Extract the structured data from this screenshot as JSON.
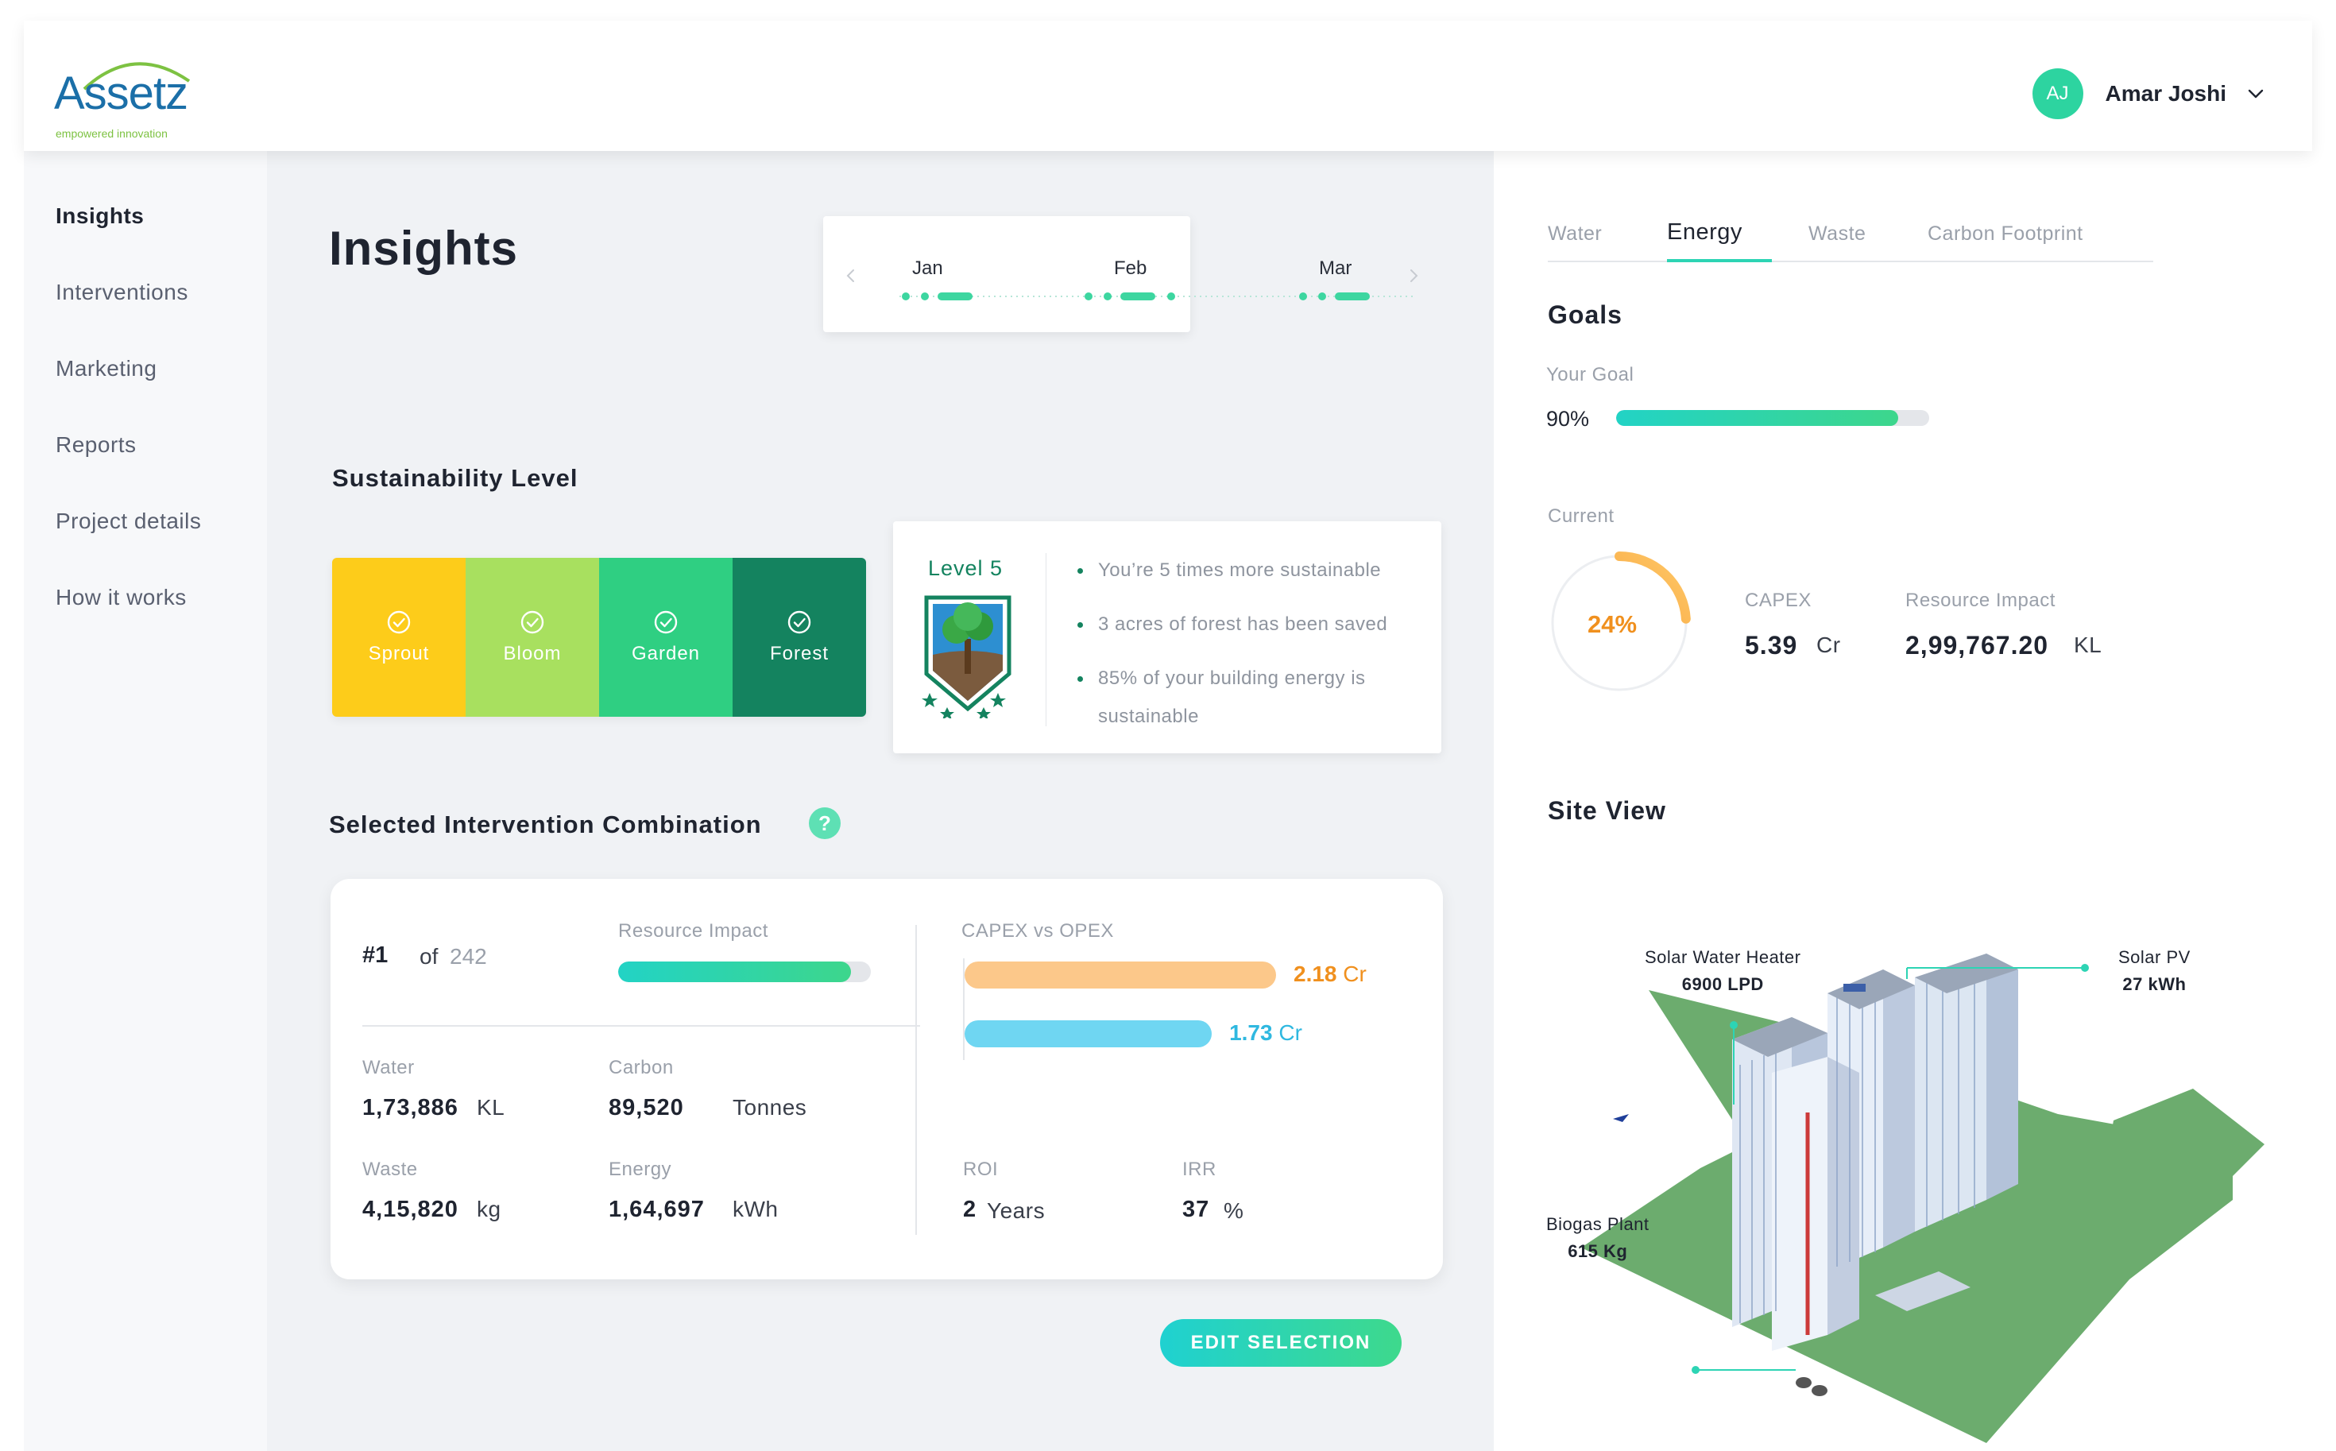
{
  "brand": {
    "name": "Assetz",
    "tagline": "empowered innovation"
  },
  "user": {
    "initials": "AJ",
    "name": "Amar Joshi"
  },
  "sidebar": {
    "items": [
      {
        "label": "Insights",
        "active": true
      },
      {
        "label": "Interventions"
      },
      {
        "label": "Marketing"
      },
      {
        "label": "Reports"
      },
      {
        "label": "Project details"
      },
      {
        "label": "How it works"
      }
    ]
  },
  "page": {
    "title": "Insights"
  },
  "timeline": {
    "months": [
      "Jan",
      "Feb",
      "Mar"
    ]
  },
  "sustainability": {
    "title": "Sustainability Level",
    "levels": [
      {
        "label": "Sprout",
        "color": "#fdcc1a"
      },
      {
        "label": "Bloom",
        "color": "#a8e05f"
      },
      {
        "label": "Garden",
        "color": "#2fcf82"
      },
      {
        "label": "Forest",
        "color": "#14835f"
      }
    ],
    "current_level": "Level 5",
    "facts": [
      "You’re 5 times more sustainable",
      "3 acres of forest has been saved",
      "85% of your building energy is sustainable"
    ]
  },
  "combination": {
    "title": "Selected Intervention Combination",
    "help": "?",
    "rank": "#1",
    "of_label": "of",
    "total": "242",
    "resource_impact_label": "Resource Impact",
    "resource_impact_level": 0.92,
    "stats": {
      "water": {
        "label": "Water",
        "value": "1,73,886",
        "unit": "KL"
      },
      "carbon": {
        "label": "Carbon",
        "value": "89,520",
        "unit": "Tonnes"
      },
      "waste": {
        "label": "Waste",
        "value": "4,15,820",
        "unit": "kg"
      },
      "energy": {
        "label": "Energy",
        "value": "1,64,697",
        "unit": "kWh"
      }
    },
    "capex_opex": {
      "label": "CAPEX vs OPEX",
      "capex": {
        "value": "2.18",
        "unit": "Cr",
        "color": "#fcc88a",
        "text_color": "#f0901e"
      },
      "opex": {
        "value": "1.73",
        "unit": "Cr",
        "color": "#6fd6f2",
        "text_color": "#2fb8e0"
      }
    },
    "roi": {
      "label": "ROI",
      "value": "2",
      "unit": "Years"
    },
    "irr": {
      "label": "IRR",
      "value": "37",
      "unit": "%"
    },
    "edit_label": "EDIT SELECTION"
  },
  "right_panel": {
    "tabs": [
      {
        "label": "Water"
      },
      {
        "label": "Energy",
        "active": true
      },
      {
        "label": "Waste"
      },
      {
        "label": "Carbon Footprint"
      }
    ],
    "goals_title": "Goals",
    "your_goal_label": "Your Goal",
    "goal_value": "90%",
    "goal_fraction": 0.9,
    "current_label": "Current",
    "current_value": "24%",
    "current_fraction": 0.24,
    "capex": {
      "label": "CAPEX",
      "value": "5.39",
      "unit": "Cr"
    },
    "resource_impact": {
      "label": "Resource Impact",
      "value": "2,99,767.20",
      "unit": "KL"
    },
    "site_view_title": "Site View",
    "site_labels": {
      "solar_water_heater": {
        "name": "Solar Water Heater",
        "value": "6900 LPD"
      },
      "solar_pv": {
        "name": "Solar PV",
        "value": "27 kWh"
      },
      "biogas_plant": {
        "name": "Biogas Plant",
        "value": "615 Kg"
      }
    }
  },
  "colors": {
    "accent": "#2dd4b4",
    "accent_green": "#3dd68c",
    "orange": "#f0901e"
  }
}
